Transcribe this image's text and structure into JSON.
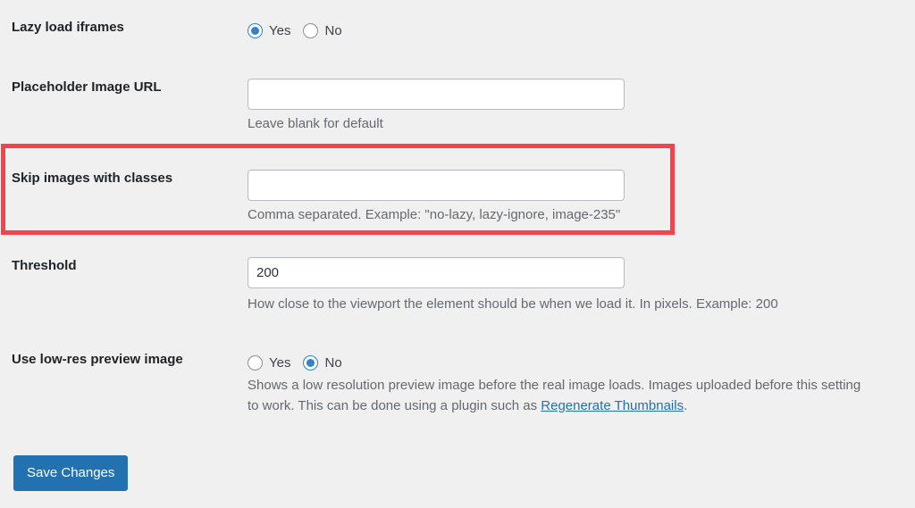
{
  "page": {
    "background_color": "#f0f0f1",
    "accent_color": "#2271b1",
    "radio_checked_color": "#3582c4",
    "highlight_color": "#f8414a",
    "link_color": "#2271b1"
  },
  "settings": {
    "lazy_load_iframes": {
      "label": "Lazy load iframes",
      "options": [
        {
          "label": "Yes",
          "checked": true
        },
        {
          "label": "No",
          "checked": false
        }
      ]
    },
    "placeholder_image_url": {
      "label": "Placeholder Image URL",
      "value": "",
      "placeholder": "",
      "description": "Leave blank for default"
    },
    "skip_images_with_classes": {
      "label": "Skip images with classes",
      "value": "",
      "placeholder": "",
      "description": "Comma separated. Example: \"no-lazy, lazy-ignore, image-235\"",
      "highlighted": true
    },
    "threshold": {
      "label": "Threshold",
      "value": "200",
      "placeholder": "",
      "description": "How close to the viewport the element should be when we load it. In pixels. Example: 200"
    },
    "use_low_res_preview_image": {
      "label": "Use low-res preview image",
      "options": [
        {
          "label": "Yes",
          "checked": false
        },
        {
          "label": "No",
          "checked": true
        }
      ],
      "description_line1": "Shows a low resolution preview image before the real image loads. Images uploaded before this setting",
      "description_line2_before_link": "to work. This can be done using a plugin such as ",
      "description_link_text": "Regenerate Thumbnails",
      "description_line2_after_link": "."
    }
  },
  "actions": {
    "save_label": "Save Changes"
  }
}
